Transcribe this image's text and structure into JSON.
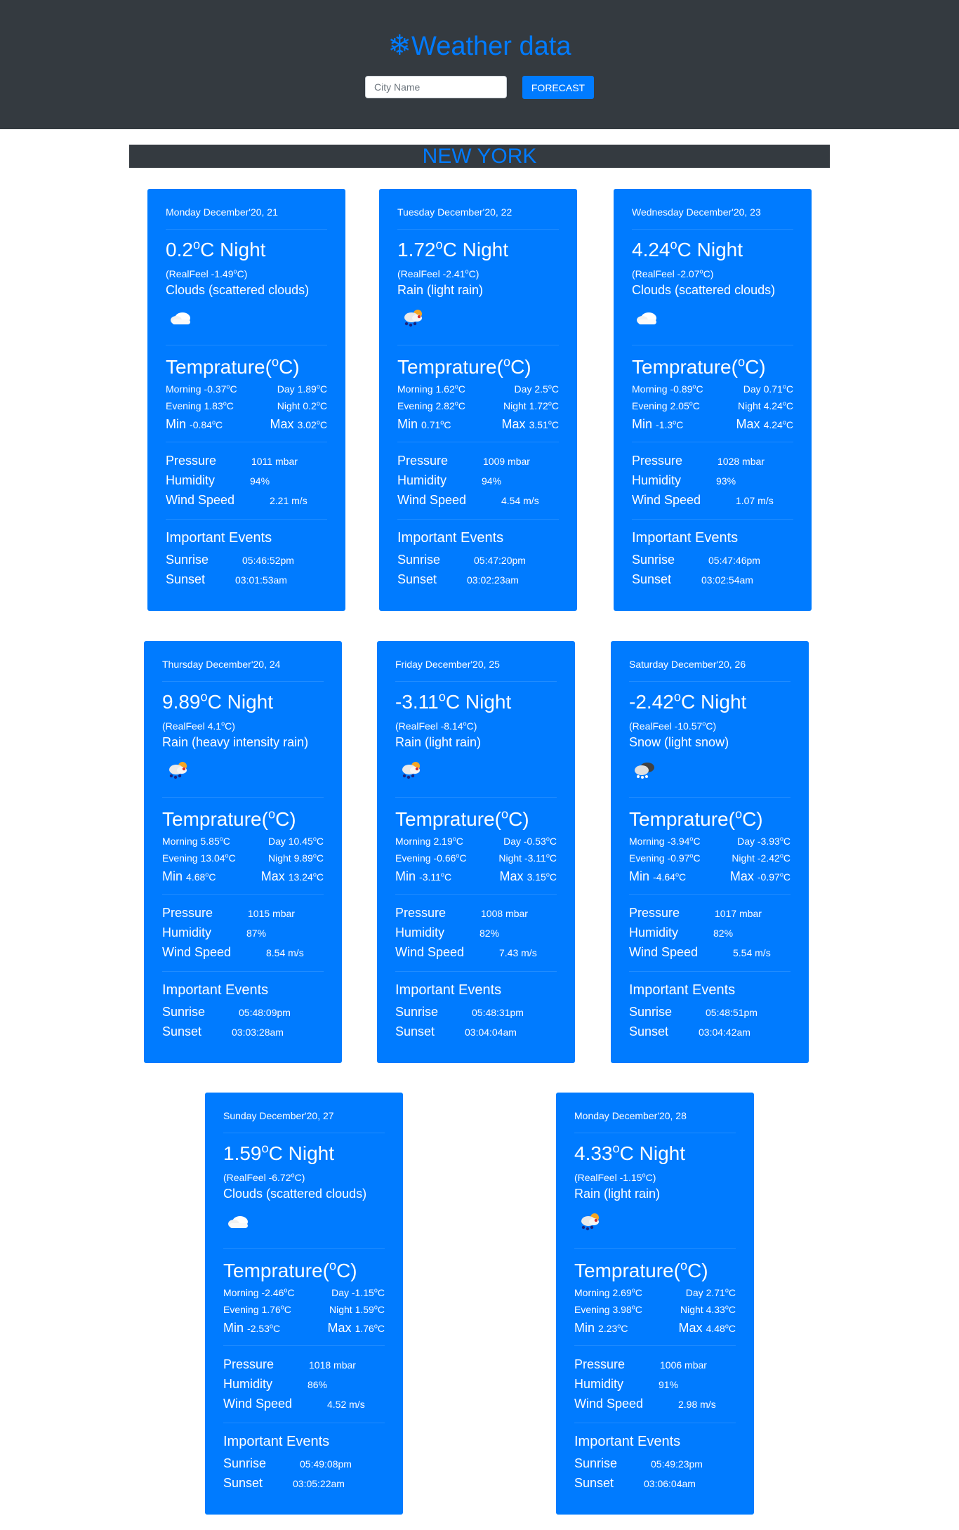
{
  "header": {
    "title_icon": "snowflake-icon",
    "title": "Weather data",
    "input_placeholder": "City Name",
    "input_value": "",
    "button_label": "FORECAST"
  },
  "city": "NEW YORK",
  "labels": {
    "temperature_title": "Temprature(",
    "temperature_unit": "o",
    "temperature_close": "C)",
    "min": "Min",
    "max": "Max",
    "morning": "Morning",
    "day": "Day",
    "evening": "Evening",
    "night": "Night",
    "pressure": "Pressure",
    "humidity": "Humidity",
    "wind_speed": "Wind Speed",
    "important_events": "Important Events",
    "sunrise": "Sunrise",
    "sunset": "Sunset",
    "realfeel": "RealFeel"
  },
  "colors": {
    "card": "#007bff",
    "header": "#343a40",
    "accent": "#007bff"
  },
  "days": [
    {
      "date": "Monday December'20, 21",
      "night": "0.2",
      "realfeel": "-1.49",
      "condition": "Clouds (scattered clouds)",
      "icon": "cloud-icon",
      "morning": "-0.37",
      "day": "1.89",
      "evening": "1.83",
      "night_t": "0.2",
      "min": "-0.84",
      "max": "3.02",
      "pressure": "1011 mbar",
      "humidity": "94%",
      "wind": "2.21 m/s",
      "sunrise": "05:46:52pm",
      "sunset": "03:01:53am"
    },
    {
      "date": "Tuesday December'20, 22",
      "night": "1.72",
      "realfeel": "-2.41",
      "condition": "Rain (light rain)",
      "icon": "rain-icon",
      "morning": "1.62",
      "day": "2.5",
      "evening": "2.82",
      "night_t": "1.72",
      "min": "0.71",
      "max": "3.51",
      "pressure": "1009 mbar",
      "humidity": "94%",
      "wind": "4.54 m/s",
      "sunrise": "05:47:20pm",
      "sunset": "03:02:23am"
    },
    {
      "date": "Wednesday December'20, 23",
      "night": "4.24",
      "realfeel": "-2.07",
      "condition": "Clouds (scattered clouds)",
      "icon": "cloud-icon",
      "morning": "-0.89",
      "day": "0.71",
      "evening": "2.05",
      "night_t": "4.24",
      "min": "-1.3",
      "max": "4.24",
      "pressure": "1028 mbar",
      "humidity": "93%",
      "wind": "1.07 m/s",
      "sunrise": "05:47:46pm",
      "sunset": "03:02:54am"
    },
    {
      "date": "Thursday December'20, 24",
      "night": "9.89",
      "realfeel": "4.1",
      "condition": "Rain (heavy intensity rain)",
      "icon": "rain-icon",
      "morning": "5.85",
      "day": "10.45",
      "evening": "13.04",
      "night_t": "9.89",
      "min": "4.68",
      "max": "13.24",
      "pressure": "1015 mbar",
      "humidity": "87%",
      "wind": "8.54 m/s",
      "sunrise": "05:48:09pm",
      "sunset": "03:03:28am"
    },
    {
      "date": "Friday December'20, 25",
      "night": "-3.11",
      "realfeel": "-8.14",
      "condition": "Rain (light rain)",
      "icon": "rain-icon",
      "morning": "2.19",
      "day": "-0.53",
      "evening": "-0.66",
      "night_t": "-3.11",
      "min": "-3.11",
      "max": "3.15",
      "pressure": "1008 mbar",
      "humidity": "82%",
      "wind": "7.43 m/s",
      "sunrise": "05:48:31pm",
      "sunset": "03:04:04am"
    },
    {
      "date": "Saturday December'20, 26",
      "night": "-2.42",
      "realfeel": "-10.57",
      "condition": "Snow (light snow)",
      "icon": "snow-cloud-icon",
      "morning": "-3.94",
      "day": "-3.93",
      "evening": "-0.97",
      "night_t": "-2.42",
      "min": "-4.64",
      "max": "-0.97",
      "pressure": "1017 mbar",
      "humidity": "82%",
      "wind": "5.54 m/s",
      "sunrise": "05:48:51pm",
      "sunset": "03:04:42am"
    },
    {
      "date": "Sunday December'20, 27",
      "night": "1.59",
      "realfeel": "-6.72",
      "condition": "Clouds (scattered clouds)",
      "icon": "cloud-icon",
      "morning": "-2.46",
      "day": "-1.15",
      "evening": "1.76",
      "night_t": "1.59",
      "min": "-2.53",
      "max": "1.76",
      "pressure": "1018 mbar",
      "humidity": "86%",
      "wind": "4.52 m/s",
      "sunrise": "05:49:08pm",
      "sunset": "03:05:22am"
    },
    {
      "date": "Monday December'20, 28",
      "night": "4.33",
      "realfeel": "-1.15",
      "condition": "Rain (light rain)",
      "icon": "rain-icon",
      "morning": "2.69",
      "day": "2.71",
      "evening": "3.98",
      "night_t": "4.33",
      "min": "2.23",
      "max": "4.48",
      "pressure": "1006 mbar",
      "humidity": "91%",
      "wind": "2.98 m/s",
      "sunrise": "05:49:23pm",
      "sunset": "03:06:04am"
    }
  ]
}
